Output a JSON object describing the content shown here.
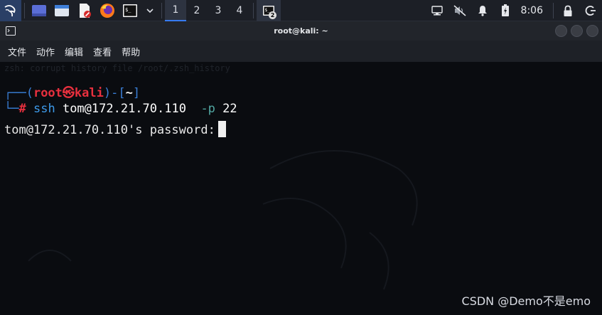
{
  "panel": {
    "workspaces": [
      "1",
      "2",
      "3",
      "4"
    ],
    "active_workspace": "1",
    "task_badge": "2",
    "clock": "8:06",
    "icons": [
      "kali-menu-icon",
      "files-window-icon",
      "file-manager-icon",
      "text-editor-icon",
      "firefox-icon",
      "terminal-icon",
      "chevron-down-icon",
      "network-icon",
      "muted-speaker-icon",
      "notification-bell-icon",
      "battery-icon",
      "lock-icon",
      "power-icon"
    ]
  },
  "window": {
    "title": "root@kali: ~"
  },
  "menu": {
    "file": "文件",
    "action": "动作",
    "edit": "编辑",
    "view": "查看",
    "help": "帮助"
  },
  "terminal": {
    "history_line": "zsh: corrupt history file /root/.zsh_history",
    "prompt_top_prefix": "┌──(",
    "user": "root",
    "skull": "㉿",
    "host": "kali",
    "prompt_mid": ")-[",
    "cwd": "~",
    "prompt_close": "]",
    "prompt_bottom_prefix": "└─",
    "hash": "#",
    "cmd_name": "ssh",
    "cmd_target": "tom@172.21.70.110",
    "cmd_option": "-p",
    "cmd_port": "22",
    "output": "tom@172.21.70.110's password:"
  },
  "watermark": "CSDN @Demo不是emo",
  "colors": {
    "prompt_blue": "#3a7fd8",
    "prompt_red": "#e8303e",
    "ssh_blue": "#3d99e8",
    "option_teal": "#52a9a3",
    "panel_bg": "#1c1f26",
    "terminal_bg": "#0a0c10"
  }
}
